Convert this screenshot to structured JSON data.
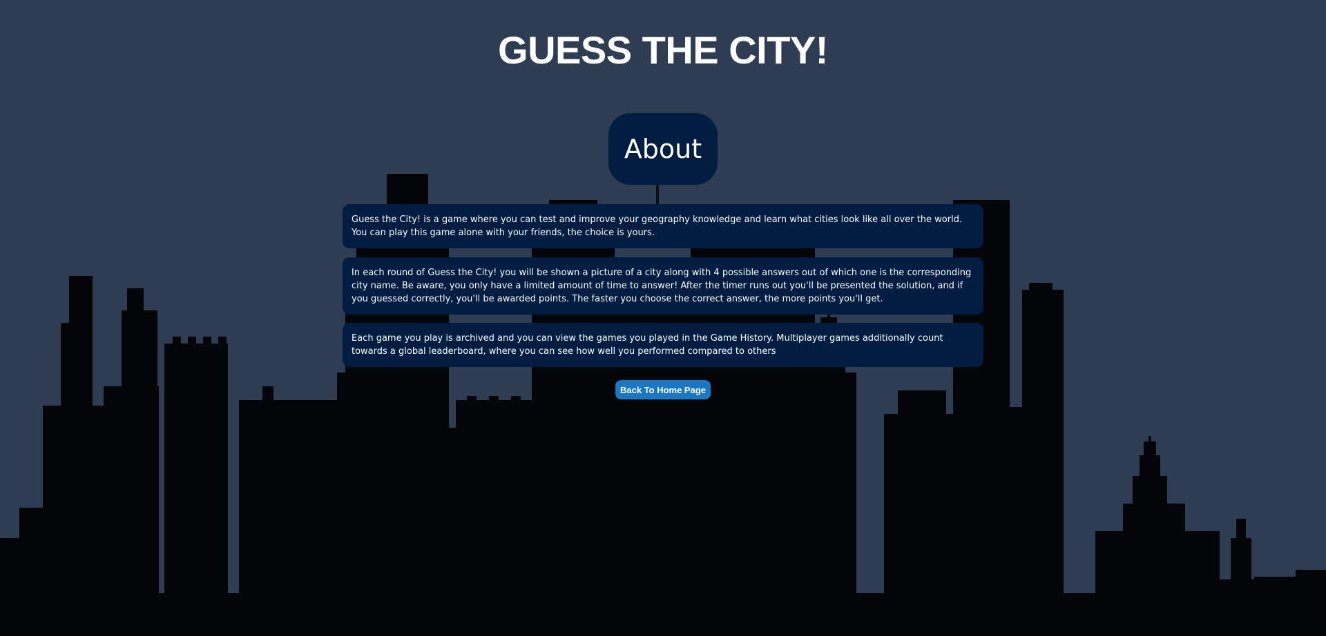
{
  "page": {
    "title": "GUESS THE CITY!"
  },
  "about": {
    "heading": "About",
    "paragraphs": [
      "Guess the City! is a game where you can test and improve your geography knowledge and learn what cities look like all over the world. You can play this game alone with your friends, the choice is yours.",
      "In each round of Guess the City! you will be shown a picture of a city along with 4 possible answers out of which one is the corresponding city name. Be aware, you only have a limited amount of time to answer! After the timer runs out you'll be presented the solution, and if you guessed correctly, you'll be awarded points. The faster you choose the correct answer, the more points you'll get.",
      "Each game you play is archived and you can view the games you played in the Game History. Multiplayer games additionally count towards a global leaderboard, where you can see how well you performed compared to others"
    ]
  },
  "navigation": {
    "back_home_label": "Back To Home Page"
  },
  "colors": {
    "background": "#2e3d52",
    "panel": "#011e42",
    "button": "#1a78c2",
    "skyline": "#030508"
  }
}
